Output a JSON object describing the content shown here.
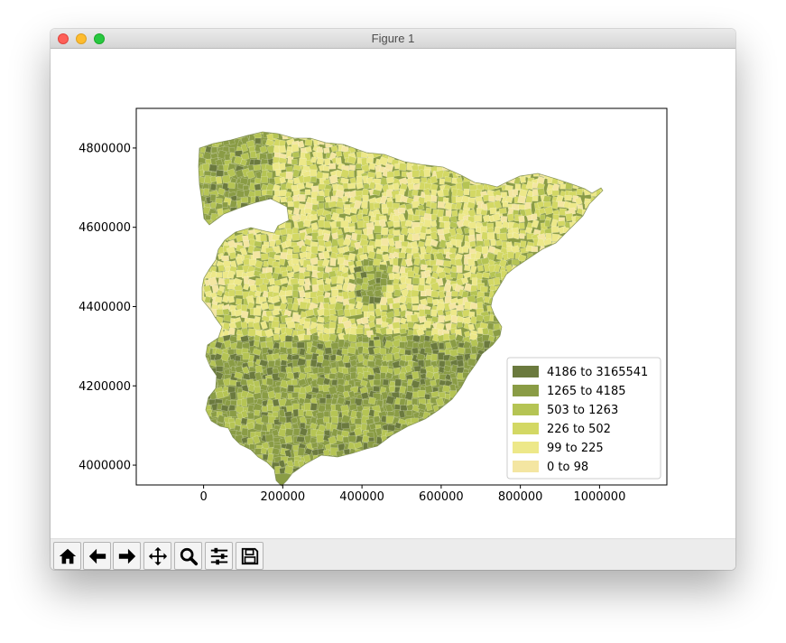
{
  "window": {
    "title": "Figure 1"
  },
  "toolbar": {
    "buttons": [
      {
        "name": "home",
        "icon": "home-icon"
      },
      {
        "name": "back",
        "icon": "back-arrow-icon"
      },
      {
        "name": "forward",
        "icon": "forward-arrow-icon"
      },
      {
        "name": "pan",
        "icon": "move-icon"
      },
      {
        "name": "zoom",
        "icon": "zoom-icon"
      },
      {
        "name": "configure-subplots",
        "icon": "sliders-icon"
      },
      {
        "name": "save",
        "icon": "save-icon"
      }
    ]
  },
  "chart_data": {
    "type": "map",
    "title": "",
    "xlabel": "",
    "ylabel": "",
    "xlim": [
      -170000,
      1170000
    ],
    "ylim": [
      3950000,
      4900000
    ],
    "xticks": [
      0,
      200000,
      400000,
      600000,
      800000,
      1000000
    ],
    "yticks": [
      4000000,
      4200000,
      4400000,
      4600000,
      4800000
    ],
    "legend": {
      "placement": "lower-right",
      "entries": [
        {
          "label": "4186 to 3165541",
          "color": "#6b7a3e"
        },
        {
          "label": "1265 to 4185",
          "color": "#8a9c45"
        },
        {
          "label": "503 to 1263",
          "color": "#b5c454"
        },
        {
          "label": "226 to 502",
          "color": "#d3d864"
        },
        {
          "label": "99 to 225",
          "color": "#ede889"
        },
        {
          "label": "0 to 98",
          "color": "#f4e6a2"
        }
      ]
    },
    "outline_color": "#ffffff"
  }
}
